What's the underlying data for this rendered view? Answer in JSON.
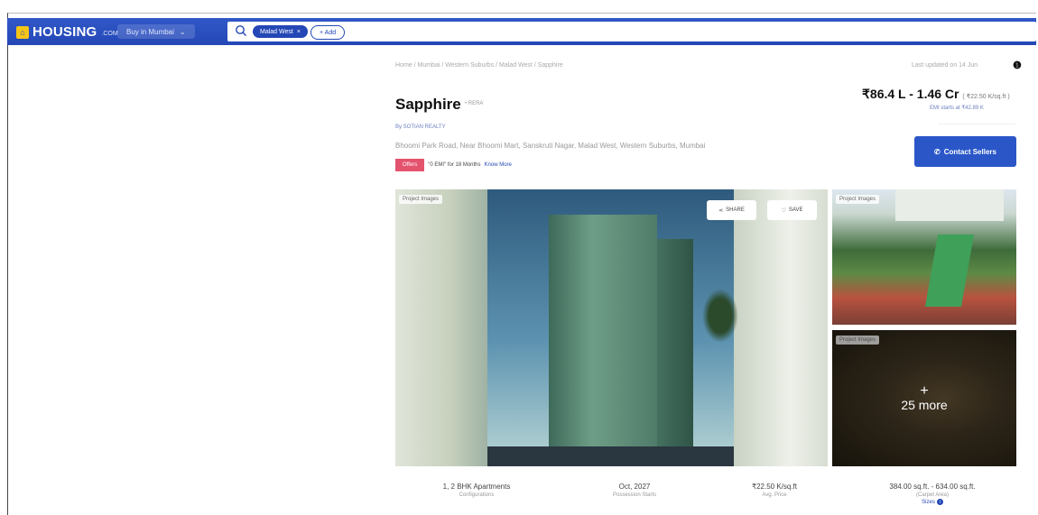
{
  "header": {
    "logo_text": "HOUSING",
    "logo_sub": ".COM",
    "city_button": "Buy in Mumbai",
    "search_chip": "Malad West",
    "add_chip": "+ Add"
  },
  "breadcrumb": "Home / Mumbai / Western Suburbs / Malad West / Sapphire",
  "breadcrumb_right": "Last updated on 14 Jun",
  "project": {
    "title": "Sapphire",
    "title_tag": "• RERA",
    "builder": "By SOTIAN REALTY",
    "address": "Bhoomi Park Road, Near Bhoomi Mart, Sanskruti Nagar, Malad West, Western Suburbs, Mumbai",
    "offer_badge": "Offers",
    "offer_text": "\"0 EMI\" for 18 Months",
    "offer_link": "Know More"
  },
  "pricing": {
    "price": "₹86.4 L - 1.46 Cr",
    "per_sqft": "( ₹22.50 K/sq.ft )",
    "emi": "EMI starts at ₹42.89 K",
    "contact_button": "Contact Sellers"
  },
  "gallery": {
    "main_tag": "Project Images",
    "share_label": "SHARE",
    "save_label": "SAVE",
    "side1_tag": "Project Images",
    "side2_tag": "Project Images",
    "more_plus": "+",
    "more_label": "25 more"
  },
  "stats": [
    {
      "value": "1, 2 BHK Apartments",
      "label": "Configurations"
    },
    {
      "value": "Oct, 2027",
      "label": "Possession Starts"
    },
    {
      "value": "₹22.50 K/sq.ft",
      "label": "Avg. Price"
    },
    {
      "value": "384.00 sq.ft. - 634.00 sq.ft.",
      "label": "(Carpet Area)",
      "link": "Sizes"
    }
  ],
  "colors": {
    "brand_blue": "#2447b6",
    "offer_pink": "#e4536e",
    "contact_blue": "#2a56c8"
  }
}
